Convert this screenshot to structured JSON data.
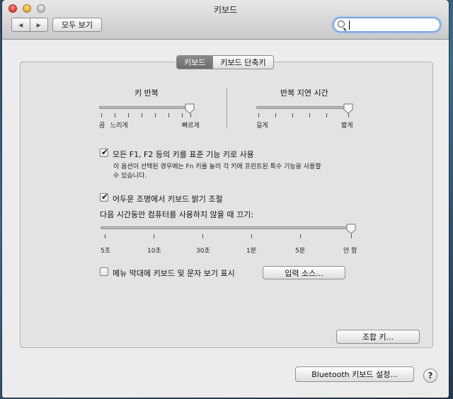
{
  "window": {
    "title": "키보드"
  },
  "toolbar": {
    "back_icon": "◀",
    "forward_icon": "▶",
    "show_all_label": "모두 보기",
    "search_value": "",
    "search_placeholder": ""
  },
  "tabs": [
    {
      "label": "키보드",
      "active": true
    },
    {
      "label": "키보드 단축키",
      "active": false
    }
  ],
  "key_repeat": {
    "title": "키 반복",
    "left_label_off": "끔",
    "left_label_slow": "느리게",
    "right_label": "빠르게",
    "value_fraction": 1.0
  },
  "delay_until_repeat": {
    "title": "반복 지연 시간",
    "left_label": "길게",
    "right_label": "짧게",
    "value_fraction": 1.0
  },
  "fn_keys": {
    "checked": true,
    "label": "모든 F1, F2 등의 키를 표준 기능 키로 사용",
    "description_line1": "이 옵션이 선택된 경우에는 Fn 키를 눌러 각 키에 프린트된 특수 기능을 사용할",
    "description_line2": "수 있습니다."
  },
  "backlight": {
    "checked": true,
    "label": "어두운 조명에서 키보드 밝기 조절",
    "off_after_label": "다음 시간동안 컴퓨터를 사용하지 않을 때 끄기:",
    "ticks": [
      "5초",
      "10초",
      "30초",
      "1분",
      "5분",
      "안 함"
    ],
    "selected": "안 함"
  },
  "menu_bar": {
    "checked": false,
    "label": "메뉴 막대에 키보드 및 문자 보기 표시",
    "input_sources_button": "입력 소스..."
  },
  "modifier_keys_button": "조합 키...",
  "bluetooth_button": "Bluetooth 키보드 설정...",
  "help_label": "?"
}
